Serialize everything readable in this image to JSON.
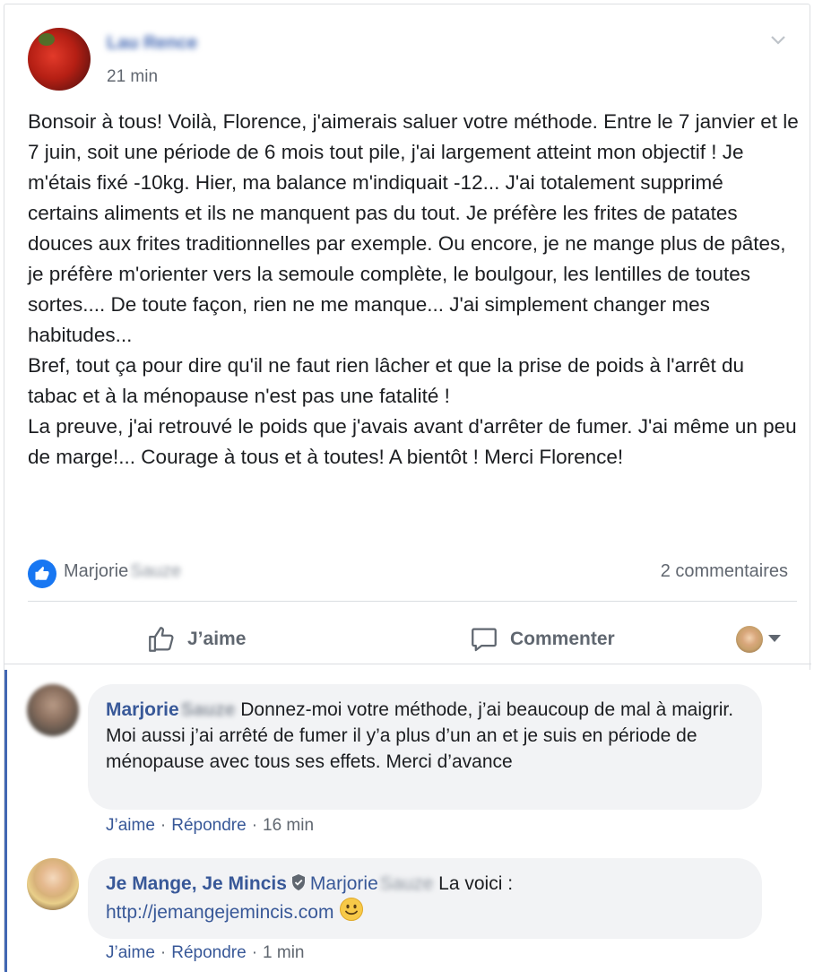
{
  "post": {
    "author_name": "Lau Rence",
    "time": "21 min",
    "paragraphs": [
      "Bonsoir à tous! Voilà, Florence, j'aimerais saluer votre méthode. Entre le 7 janvier et le 7 juin, soit une période de 6 mois tout pile, j'ai largement atteint mon objectif ! Je m'étais fixé -10kg. Hier, ma balance m'indiquait -12... J'ai totalement supprimé certains aliments et ils ne manquent pas du tout. Je préfère les frites de patates douces aux frites traditionnelles par exemple. Ou encore, je ne mange plus de pâtes, je préfère m'orienter vers la semoule complète, le boulgour, les lentilles de toutes sortes.... De toute façon, rien ne me manque... J'ai simplement changer mes habitudes...",
      "Bref, tout ça pour dire qu'il ne faut rien lâcher et que la prise de poids à l'arrêt du tabac et à la ménopause n'est pas une fatalité !",
      "La preuve, j'ai retrouvé le poids que j'avais avant d'arrêter de fumer. J'ai même un peu de marge!... Courage à tous et à toutes! A bientôt ! Merci Florence!"
    ]
  },
  "reactions": {
    "liker_first": "Marjorie",
    "liker_last": "Sauze",
    "comments_count": "2 commentaires"
  },
  "actions": {
    "like_label": "J’aime",
    "comment_label": "Commenter"
  },
  "comments": [
    {
      "author_first": "Marjorie",
      "author_last": "Sauze",
      "text": "Donnez-moi votre méthode, j’ai beaucoup de mal à maigrir. Moi aussi j’ai arrêté de fumer il y’a plus d’un an et je suis en période de ménopause avec tous ses effets. Merci d’avance",
      "like": "J’aime",
      "reply": "Répondre",
      "time": "16 min"
    },
    {
      "author": "Je Mange, Je Mincis",
      "mention_first": "Marjorie",
      "mention_last": "Sauze",
      "text": "La voici :",
      "link": "http://jemangejemincis.com",
      "like": "J’aime",
      "reply": "Répondre",
      "time": "1 min"
    }
  ],
  "icons": {
    "options": "chevron-down-icon",
    "like_badge": "thumbs-up-icon",
    "like_action": "thumbs-up-outline-icon",
    "comment_action": "speech-bubble-icon",
    "page_badge": "shield-icon",
    "emoji": "smiley-icon"
  },
  "colors": {
    "link": "#385898",
    "like_badge": "#1877f2",
    "muted": "#606770",
    "bubble": "#f2f3f5",
    "thread_bar": "#4267b2"
  }
}
